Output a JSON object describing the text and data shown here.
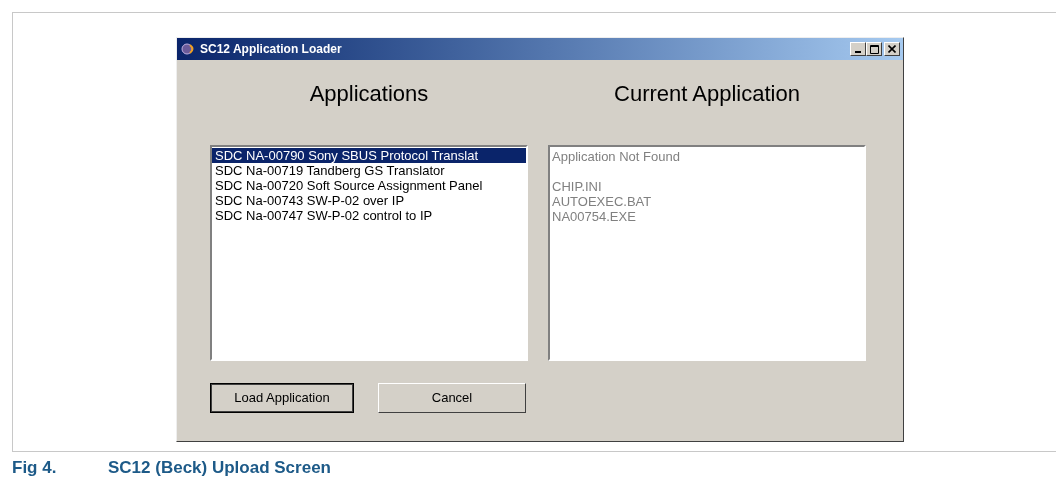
{
  "window": {
    "title": "SC12 Application Loader"
  },
  "applications": {
    "heading": "Applications",
    "items": [
      {
        "label": "SDC NA-00790 Sony SBUS Protocol Translat",
        "selected": true
      },
      {
        "label": "SDC Na-00719 Tandberg GS Translator",
        "selected": false
      },
      {
        "label": "SDC Na-00720 Soft Source Assignment Panel",
        "selected": false
      },
      {
        "label": "SDC Na-00743 SW-P-02 over IP",
        "selected": false
      },
      {
        "label": "SDC Na-00747 SW-P-02 control to IP",
        "selected": false
      }
    ]
  },
  "current_application": {
    "heading": "Current Application",
    "status": "Application Not Found",
    "files": [
      "CHIP.INI",
      "AUTOEXEC.BAT",
      "NA00754.EXE"
    ]
  },
  "buttons": [
    {
      "label": "Load Application",
      "default": true
    },
    {
      "label": "Cancel",
      "default": false
    }
  ],
  "caption": {
    "number": "Fig 4.",
    "title": "SC12 (Beck) Upload Screen"
  }
}
